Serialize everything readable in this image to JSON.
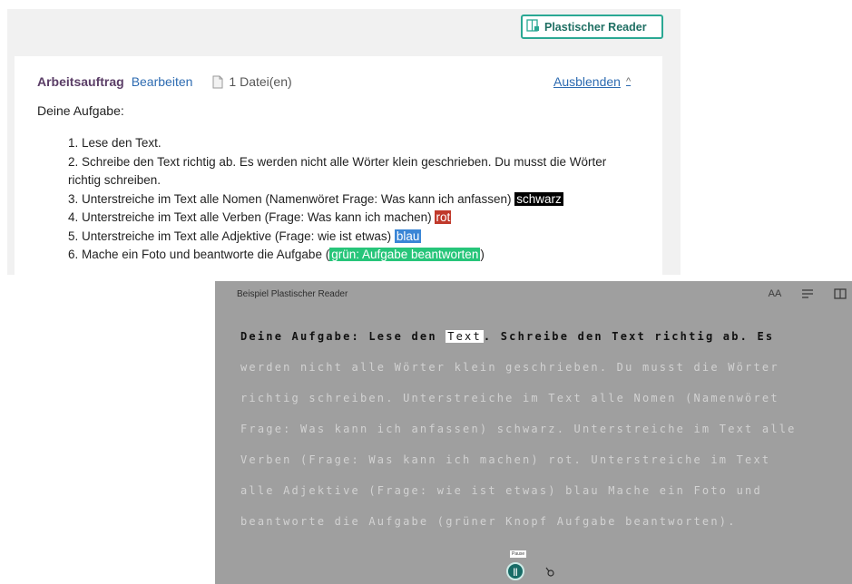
{
  "toolbar": {
    "reader_button_label": "Plastischer Reader",
    "reader_button_icon": "reader-icon"
  },
  "card": {
    "title": "Arbeitsauftrag",
    "edit_label": "Bearbeiten",
    "files_label": "1 Datei(en)",
    "hide_label": "Ausblenden",
    "subtitle": "Deine Aufgabe:",
    "items": [
      {
        "text": "1. Lese den Text."
      },
      {
        "text": "2. Schreibe den Text richtig ab. Es werden nicht alle Wörter klein geschrieben. Du musst die Wörter richtig schreiben."
      },
      {
        "text": "3. Unterstreiche im Text alle Nomen (Namenwöret Frage: Was kann ich anfassen)",
        "highlight": "schwarz"
      },
      {
        "text": "4. Unterstreiche im Text alle Verben (Frage: Was kann ich machen)",
        "highlight": "rot"
      },
      {
        "text": "5. Unterstreiche im Text alle Adjektive (Frage: wie ist etwas)",
        "highlight": "blau"
      },
      {
        "text": "6. Mache ein Foto und beantworte die Aufgabe (",
        "highlight": "grün: Aufgabe beantworten",
        "after": ")"
      }
    ]
  },
  "reader": {
    "title": "Beispiel Plastischer Reader",
    "tools": [
      "text-size-icon",
      "text-preferences-icon",
      "book-icon"
    ],
    "text_size_label": "AA",
    "active_before": "Deine Aufgabe: Lese den ",
    "active_word": "Text",
    "active_after": ". Schreibe den Text richtig ab. Es",
    "rest_lines": [
      "werden nicht alle Wörter klein geschrieben. Du musst die Wörter",
      "richtig schreiben. Unterstreiche im Text alle Nomen (Namenwöret",
      "Frage: Was kann ich anfassen) schwarz. Unterstreiche im Text alle",
      "Verben (Frage: Was kann ich machen) rot. Unterstreiche im Text",
      "alle Adjektive (Frage: wie ist etwas) blau Mache ein Foto und",
      "beantworte die Aufgabe (grüner Knopf Aufgabe beantworten)."
    ],
    "pause_tooltip": "Pause",
    "pause_icon": "pause-icon",
    "speed_icon": "reading-speed-icon"
  },
  "colors": {
    "accent": "#2aa893",
    "link": "#2d6bb1",
    "title": "#5a3d66",
    "reader_bg": "#9f9f9f"
  }
}
